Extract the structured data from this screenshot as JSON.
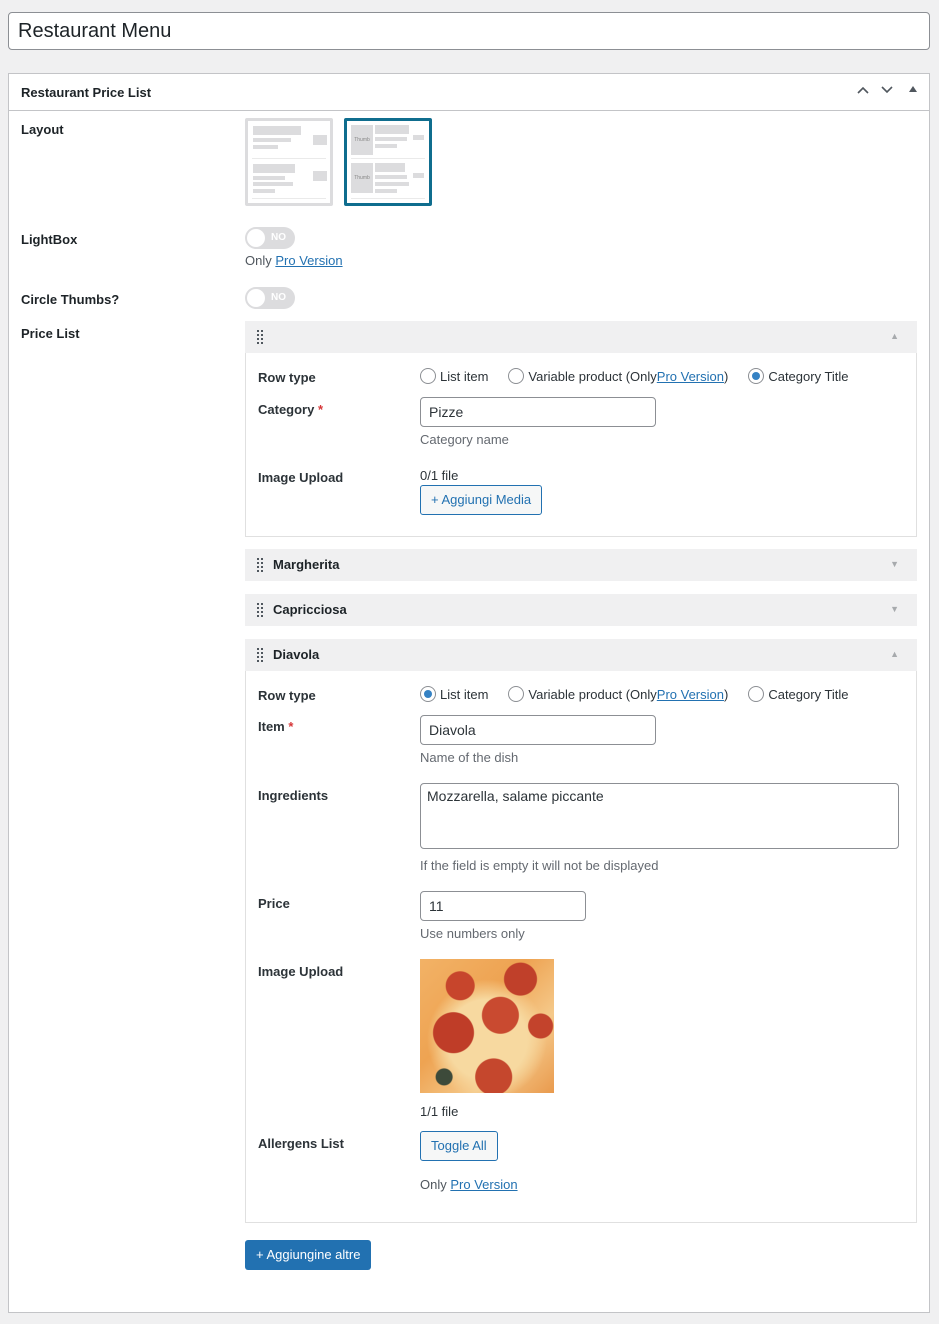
{
  "title_input": {
    "value": "Restaurant Menu"
  },
  "metabox": {
    "title": "Restaurant Price List",
    "controls": {
      "move_up": "chevron-up-icon",
      "move_down": "chevron-down-icon",
      "toggle": "triangle-up-icon"
    }
  },
  "settings": {
    "layout": {
      "label": "Layout",
      "options": [
        {
          "name": "list-layout",
          "selected": false
        },
        {
          "name": "thumb-layout",
          "selected": true,
          "thumb_text": "Thumb"
        }
      ]
    },
    "lightbox": {
      "label": "LightBox",
      "toggle": "NO",
      "note_prefix": "Only",
      "note_link": "Pro Version"
    },
    "circle_thumbs": {
      "label": "Circle Thumbs?",
      "toggle": "NO"
    },
    "price_list": {
      "label": "Price List"
    }
  },
  "groups": [
    {
      "title": "",
      "expanded": true,
      "row_type_label": "Row type",
      "radio_options": [
        "List item",
        "Variable product (Only ",
        "Pro Version",
        ")",
        "Category Title"
      ],
      "selected": "Category Title",
      "fields": {
        "category_label": "Category",
        "category_value": "Pizze",
        "category_desc": "Category name",
        "image_label": "Image Upload",
        "image_count": "0/1 file",
        "add_media_button": "+ Aggiungi Media"
      }
    },
    {
      "title": "Margherita",
      "expanded": false
    },
    {
      "title": "Capricciosa",
      "expanded": false
    },
    {
      "title": "Diavola",
      "expanded": true,
      "row_type_label": "Row type",
      "radio_options": [
        "List item",
        "Variable product (Only ",
        "Pro Version",
        ")",
        "Category Title"
      ],
      "selected": "List item",
      "fields": {
        "item_label": "Item",
        "item_value": "Diavola",
        "item_desc": "Name of the dish",
        "ingredients_label": "Ingredients",
        "ingredients_value": "Mozzarella, salame piccante",
        "ingredients_desc": "If the field is empty it will not be displayed",
        "price_label": "Price",
        "price_value": "11",
        "price_desc": "Use numbers only",
        "image_label": "Image Upload",
        "image_count": "1/1 file",
        "allergens_label": "Allergens List",
        "toggle_all_button": "Toggle All",
        "allergens_note_prefix": "Only",
        "allergens_note_link": "Pro Version"
      }
    }
  ],
  "required_marker": "*",
  "add_more_button": "+ Aggiungine altre"
}
